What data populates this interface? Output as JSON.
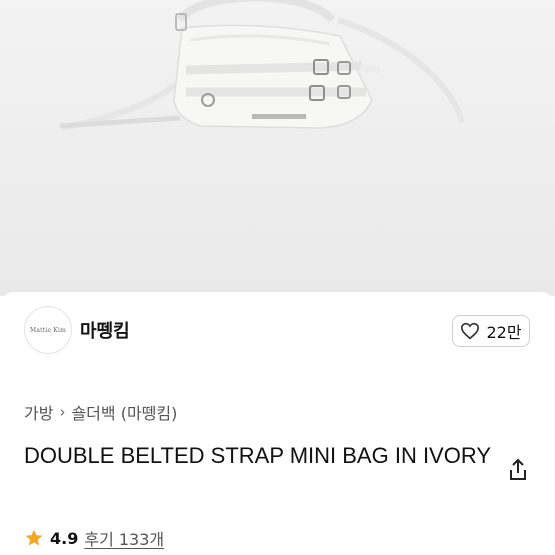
{
  "product_image": {
    "alt": "white double belted strap mini bag"
  },
  "brand": {
    "logo_text": "Mattie Kim",
    "name": "마뗑킴"
  },
  "like": {
    "count": "22만",
    "icon": "heart-outline-icon"
  },
  "breadcrumb": {
    "category": "가방",
    "subcategory": "숄더백 (마뗑킴)"
  },
  "product": {
    "title": "DOUBLE BELTED STRAP MINI BAG IN IVORY"
  },
  "rating": {
    "value": "4.9",
    "reviews_label": "후기 133개"
  },
  "colors": {
    "star": "#f5a623",
    "text": "#111111",
    "muted": "#555555"
  }
}
